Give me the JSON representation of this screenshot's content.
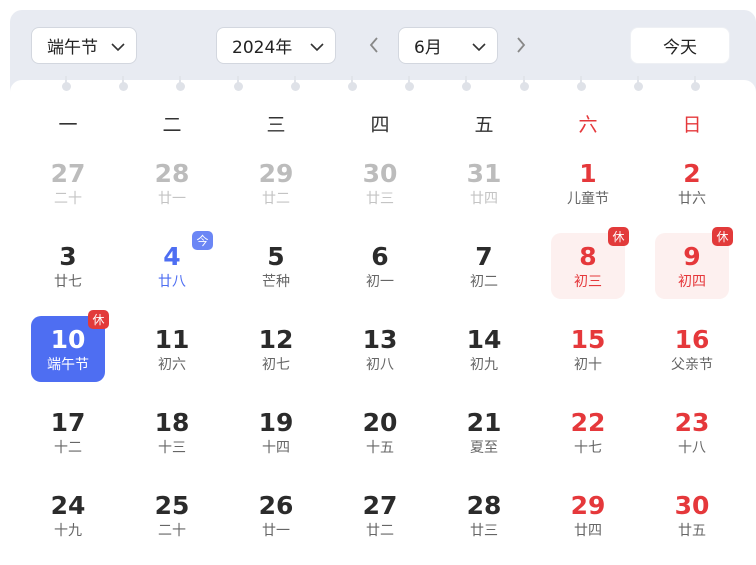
{
  "toolbar": {
    "holiday_select": "端午节",
    "year_select": "2024年",
    "month_select": "6月",
    "today_button": "今天"
  },
  "weekdays": [
    "一",
    "二",
    "三",
    "四",
    "五",
    "六",
    "日"
  ],
  "weekend_color": "#e5383b",
  "accent_color": "#4e6ef2",
  "days": [
    {
      "num": "27",
      "sub": "二十",
      "state": "other"
    },
    {
      "num": "28",
      "sub": "廿一",
      "state": "other"
    },
    {
      "num": "29",
      "sub": "廿二",
      "state": "other"
    },
    {
      "num": "30",
      "sub": "廿三",
      "state": "other"
    },
    {
      "num": "31",
      "sub": "廿四",
      "state": "other"
    },
    {
      "num": "1",
      "sub": "儿童节",
      "state": "weekend"
    },
    {
      "num": "2",
      "sub": "廿六",
      "state": "weekend"
    },
    {
      "num": "3",
      "sub": "廿七",
      "state": "normal"
    },
    {
      "num": "4",
      "sub": "廿八",
      "state": "today",
      "badge": "今"
    },
    {
      "num": "5",
      "sub": "芒种",
      "state": "normal"
    },
    {
      "num": "6",
      "sub": "初一",
      "state": "normal"
    },
    {
      "num": "7",
      "sub": "初二",
      "state": "normal"
    },
    {
      "num": "8",
      "sub": "初三",
      "state": "holiday",
      "badge": "休"
    },
    {
      "num": "9",
      "sub": "初四",
      "state": "holiday",
      "badge": "休"
    },
    {
      "num": "10",
      "sub": "端午节",
      "state": "selected",
      "badge": "休"
    },
    {
      "num": "11",
      "sub": "初六",
      "state": "normal"
    },
    {
      "num": "12",
      "sub": "初七",
      "state": "normal"
    },
    {
      "num": "13",
      "sub": "初八",
      "state": "normal"
    },
    {
      "num": "14",
      "sub": "初九",
      "state": "normal"
    },
    {
      "num": "15",
      "sub": "初十",
      "state": "weekend"
    },
    {
      "num": "16",
      "sub": "父亲节",
      "state": "weekend"
    },
    {
      "num": "17",
      "sub": "十二",
      "state": "normal"
    },
    {
      "num": "18",
      "sub": "十三",
      "state": "normal"
    },
    {
      "num": "19",
      "sub": "十四",
      "state": "normal"
    },
    {
      "num": "20",
      "sub": "十五",
      "state": "normal"
    },
    {
      "num": "21",
      "sub": "夏至",
      "state": "normal"
    },
    {
      "num": "22",
      "sub": "十七",
      "state": "weekend"
    },
    {
      "num": "23",
      "sub": "十八",
      "state": "weekend"
    },
    {
      "num": "24",
      "sub": "十九",
      "state": "normal"
    },
    {
      "num": "25",
      "sub": "二十",
      "state": "normal"
    },
    {
      "num": "26",
      "sub": "廿一",
      "state": "normal"
    },
    {
      "num": "27",
      "sub": "廿二",
      "state": "normal"
    },
    {
      "num": "28",
      "sub": "廿三",
      "state": "normal"
    },
    {
      "num": "29",
      "sub": "廿四",
      "state": "weekend"
    },
    {
      "num": "30",
      "sub": "廿五",
      "state": "weekend"
    }
  ]
}
